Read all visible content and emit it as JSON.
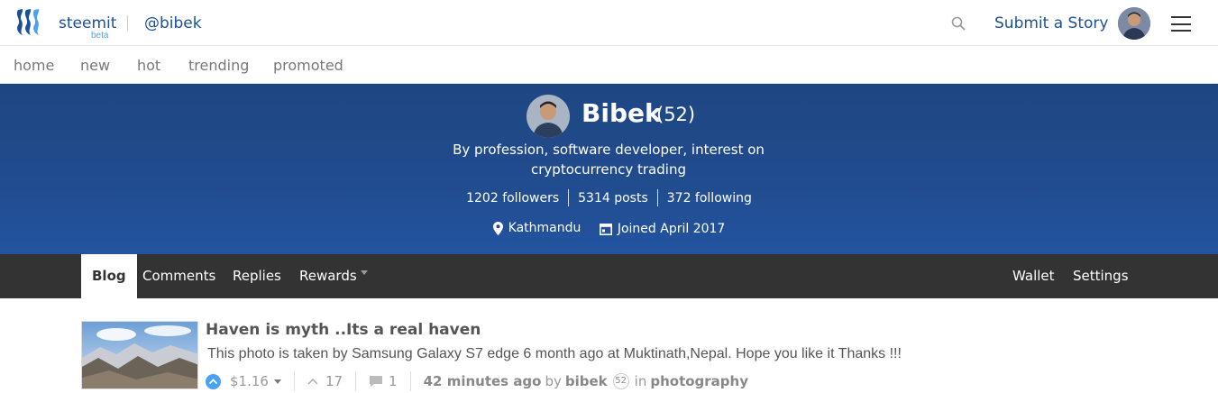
{
  "header": {
    "brand": "steemit",
    "brand_sub": "beta",
    "user_handle": "@bibek",
    "submit_label": "Submit a Story"
  },
  "subnav": {
    "items": [
      "home",
      "new",
      "hot",
      "trending",
      "promoted"
    ]
  },
  "profile": {
    "name": "Bibek",
    "reputation": "(52)",
    "bio": "By profession, software developer, interest on cryptocurrency trading",
    "followers": "1202 followers",
    "posts": "5314 posts",
    "following": "372 following",
    "location": "Kathmandu",
    "joined": "Joined April 2017"
  },
  "tabs": {
    "blog": "Blog",
    "comments": "Comments",
    "replies": "Replies",
    "rewards": "Rewards",
    "wallet": "Wallet",
    "settings": "Settings"
  },
  "post": {
    "title": "Haven is myth ..Its a real haven",
    "body": "This photo is taken by Samsung Galaxy S7 edge 6 month ago at Muktinath,Nepal. Hope you like it Thanks !!!",
    "payout": "$1.16",
    "votes": "17",
    "comments": "1",
    "time": "42 minutes ago",
    "by": "by",
    "author": "bibek",
    "author_rep": "52",
    "in": "in",
    "category": "photography"
  },
  "colors": {
    "brand_blue": "#1a5099",
    "banner": "#214c8f",
    "tabs_bg": "#333333",
    "vote_blue": "#4ba2f2"
  }
}
